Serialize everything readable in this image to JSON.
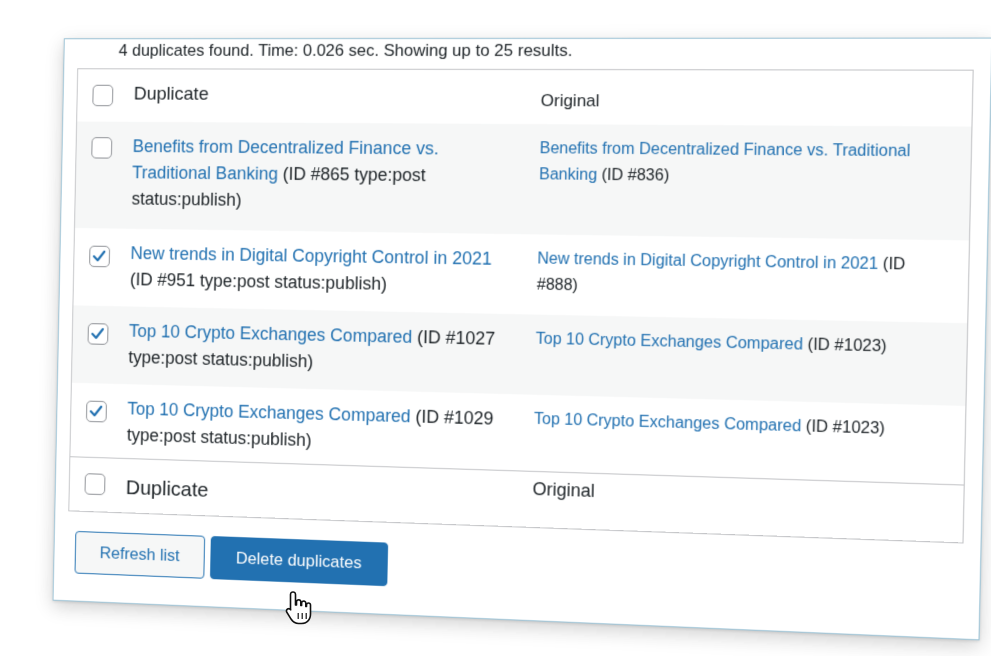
{
  "summary_text": "4 duplicates found. Time: 0.026 sec. Showing up to 25 results.",
  "table": {
    "header": {
      "duplicate_label": "Duplicate",
      "original_label": "Original"
    },
    "footer": {
      "duplicate_label": "Duplicate",
      "original_label": "Original"
    },
    "rows": [
      {
        "checked": false,
        "duplicate_title": "Benefits from Decentralized Finance vs. Traditional Banking",
        "duplicate_meta": "(ID #865 type:post status:publish)",
        "original_title": "Benefits from Decentralized Finance vs. Traditional Banking",
        "original_meta": "(ID #836)"
      },
      {
        "checked": true,
        "duplicate_title": "New trends in Digital Copyright Control in 2021",
        "duplicate_meta": "(ID #951 type:post status:publish)",
        "original_title": "New trends in Digital Copyright Control in 2021",
        "original_meta": "(ID #888)"
      },
      {
        "checked": true,
        "duplicate_title": "Top 10 Crypto Exchanges Compared",
        "duplicate_meta": "(ID #1027 type:post status:publish)",
        "original_title": "Top 10 Crypto Exchanges Compared",
        "original_meta": "(ID #1023)"
      },
      {
        "checked": true,
        "duplicate_title": "Top 10 Crypto Exchanges Compared",
        "duplicate_meta": "(ID #1029 type:post status:publish)",
        "original_title": "Top 10 Crypto Exchanges Compared",
        "original_meta": "(ID #1023)"
      }
    ]
  },
  "buttons": {
    "refresh_label": "Refresh list",
    "delete_label": "Delete duplicates"
  },
  "colors": {
    "link": "#2271b1",
    "primary_button": "#2271b1",
    "checkbox_check": "#2271b1"
  },
  "icons": {
    "check": "checkmark-icon",
    "cursor": "hand-pointer-icon"
  }
}
